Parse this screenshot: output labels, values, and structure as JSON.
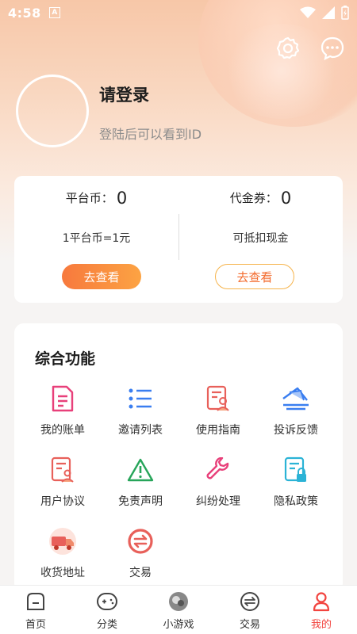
{
  "status_bar": {
    "time": "4:58",
    "badge": "A"
  },
  "profile": {
    "title": "请登录",
    "subtitle": "登陆后可以看到ID"
  },
  "wallet": {
    "platform_coin_label": "平台币：",
    "platform_coin_value": "0",
    "platform_coin_note": "1平台币=1元",
    "platform_coin_button": "去查看",
    "voucher_label": "代金券：",
    "voucher_value": "0",
    "voucher_note": "可抵扣现金",
    "voucher_button": "去查看"
  },
  "features": {
    "title": "综合功能",
    "items": [
      {
        "label": "我的账单",
        "icon": "bill-icon"
      },
      {
        "label": "邀请列表",
        "icon": "list-icon"
      },
      {
        "label": "使用指南",
        "icon": "guide-icon"
      },
      {
        "label": "投诉反馈",
        "icon": "feedback-icon"
      },
      {
        "label": "用户协议",
        "icon": "agreement-icon"
      },
      {
        "label": "免责声明",
        "icon": "warning-icon"
      },
      {
        "label": "纠纷处理",
        "icon": "wrench-icon"
      },
      {
        "label": "隐私政策",
        "icon": "privacy-icon"
      },
      {
        "label": "收货地址",
        "icon": "delivery-truck-icon"
      },
      {
        "label": "交易",
        "icon": "exchange-icon"
      }
    ]
  },
  "tabbar": {
    "items": [
      {
        "label": "首页",
        "icon": "home-icon"
      },
      {
        "label": "分类",
        "icon": "category-icon"
      },
      {
        "label": "小游戏",
        "icon": "minigame-icon"
      },
      {
        "label": "交易",
        "icon": "trade-icon"
      },
      {
        "label": "我的",
        "icon": "profile-icon",
        "active": true
      }
    ]
  },
  "colors": {
    "accent": "#f2443f",
    "orange": "#f7793d",
    "blue": "#3a7ef0",
    "pink": "#e8407a"
  }
}
